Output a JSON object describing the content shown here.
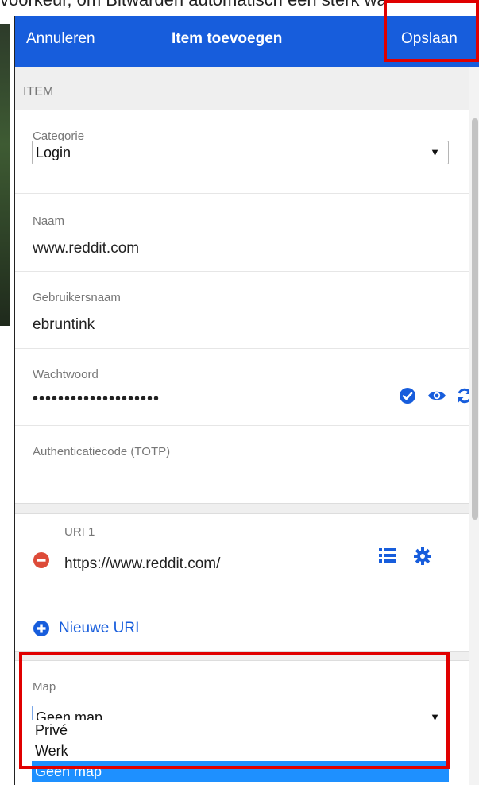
{
  "caption_text": "voorkeur, om Bitwarden automatisch een sterk wa",
  "header": {
    "cancel": "Annuleren",
    "title": "Item toevoegen",
    "save": "Opslaan"
  },
  "item_section": "ITEM",
  "fields": {
    "category_label": "Categorie",
    "category_value": "Login",
    "name_label": "Naam",
    "name_value": "www.reddit.com",
    "username_label": "Gebruikersnaam",
    "username_value": "ebruntink",
    "password_label": "Wachtwoord",
    "password_value": "••••••••••••••••••••",
    "totp_label": "Authenticatiecode (TOTP)"
  },
  "uri": {
    "label": "URI 1",
    "value": "https://www.reddit.com/",
    "new_uri": "Nieuwe URI"
  },
  "map": {
    "label": "Map",
    "selected": "Geen map",
    "options": [
      "Privé",
      "Werk",
      "Geen map"
    ]
  },
  "colors": {
    "accent": "#175ddc",
    "remove": "#dd4b39",
    "highlight": "#e00000"
  },
  "icons": [
    "check-icon",
    "eye-icon",
    "refresh-icon",
    "minus-circle-icon",
    "list-icon",
    "gear-icon",
    "plus-circle-icon"
  ]
}
